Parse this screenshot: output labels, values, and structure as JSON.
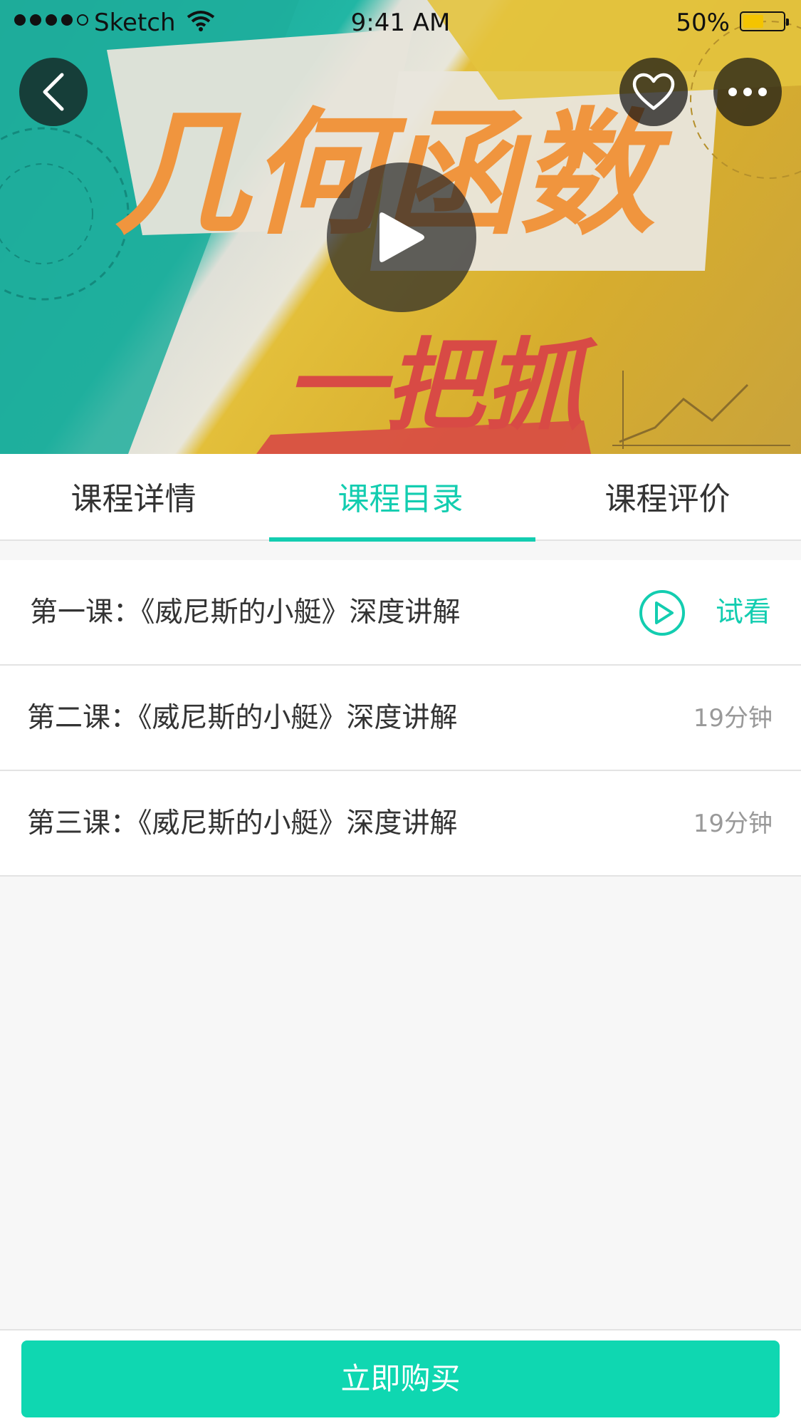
{
  "status_bar": {
    "carrier": "Sketch",
    "time": "9:41 AM",
    "battery_percent": "50%",
    "battery_level": 0.5
  },
  "hero": {
    "title_line1": "几何函数",
    "title_line2": "一把抓",
    "buttons": {
      "back_icon": "chevron-left-icon",
      "favorite_icon": "heart-icon",
      "more_icon": "ellipsis-icon",
      "play_icon": "play-icon"
    }
  },
  "tabs": [
    {
      "label": "课程详情",
      "active": false
    },
    {
      "label": "课程目录",
      "active": true
    },
    {
      "label": "课程评价",
      "active": false
    }
  ],
  "lessons": [
    {
      "title": "第一课：《威尼斯的小艇》深度讲解",
      "action": "试看"
    },
    {
      "title": "第二课：《威尼斯的小艇》深度讲解",
      "duration": "19分钟"
    },
    {
      "title": "第三课：《威尼斯的小艇》深度讲解",
      "duration": "19分钟"
    }
  ],
  "footer": {
    "buy_label": "立即购买"
  },
  "colors": {
    "accent": "#13cdb0",
    "buy_button": "#0fd7b1",
    "text_primary": "#333333",
    "text_secondary": "#999999"
  }
}
